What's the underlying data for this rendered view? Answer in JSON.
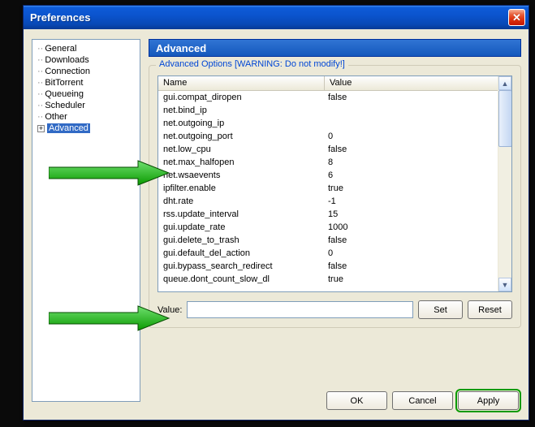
{
  "window": {
    "title": "Preferences"
  },
  "icons": {
    "close": "✕",
    "up": "▲",
    "down": "▼",
    "plus": "+"
  },
  "sidebar": {
    "items": [
      {
        "label": "General",
        "selected": false,
        "expandable": false
      },
      {
        "label": "Downloads",
        "selected": false,
        "expandable": false
      },
      {
        "label": "Connection",
        "selected": false,
        "expandable": false
      },
      {
        "label": "BitTorrent",
        "selected": false,
        "expandable": false
      },
      {
        "label": "Queueing",
        "selected": false,
        "expandable": false
      },
      {
        "label": "Scheduler",
        "selected": false,
        "expandable": false
      },
      {
        "label": "Other",
        "selected": false,
        "expandable": false
      },
      {
        "label": "Advanced",
        "selected": true,
        "expandable": true
      }
    ]
  },
  "content": {
    "heading": "Advanced",
    "group_legend": "Advanced Options [WARNING: Do not modify!]",
    "columns": {
      "name": "Name",
      "value": "Value"
    },
    "rows": [
      {
        "name": "gui.compat_diropen",
        "value": "false"
      },
      {
        "name": "net.bind_ip",
        "value": ""
      },
      {
        "name": "net.outgoing_ip",
        "value": ""
      },
      {
        "name": "net.outgoing_port",
        "value": "0"
      },
      {
        "name": "net.low_cpu",
        "value": "false"
      },
      {
        "name": "net.max_halfopen",
        "value": "8"
      },
      {
        "name": "net.wsaevents",
        "value": "6"
      },
      {
        "name": "ipfilter.enable",
        "value": "true"
      },
      {
        "name": "dht.rate",
        "value": "-1"
      },
      {
        "name": "rss.update_interval",
        "value": "15"
      },
      {
        "name": "gui.update_rate",
        "value": "1000"
      },
      {
        "name": "gui.delete_to_trash",
        "value": "false"
      },
      {
        "name": "gui.default_del_action",
        "value": "0"
      },
      {
        "name": "gui.bypass_search_redirect",
        "value": "false"
      },
      {
        "name": "queue.dont_count_slow_dl",
        "value": "true"
      }
    ],
    "value_label": "Value:",
    "value_input": "",
    "buttons": {
      "set": "Set",
      "reset": "Reset"
    }
  },
  "footer": {
    "ok": "OK",
    "cancel": "Cancel",
    "apply": "Apply"
  }
}
